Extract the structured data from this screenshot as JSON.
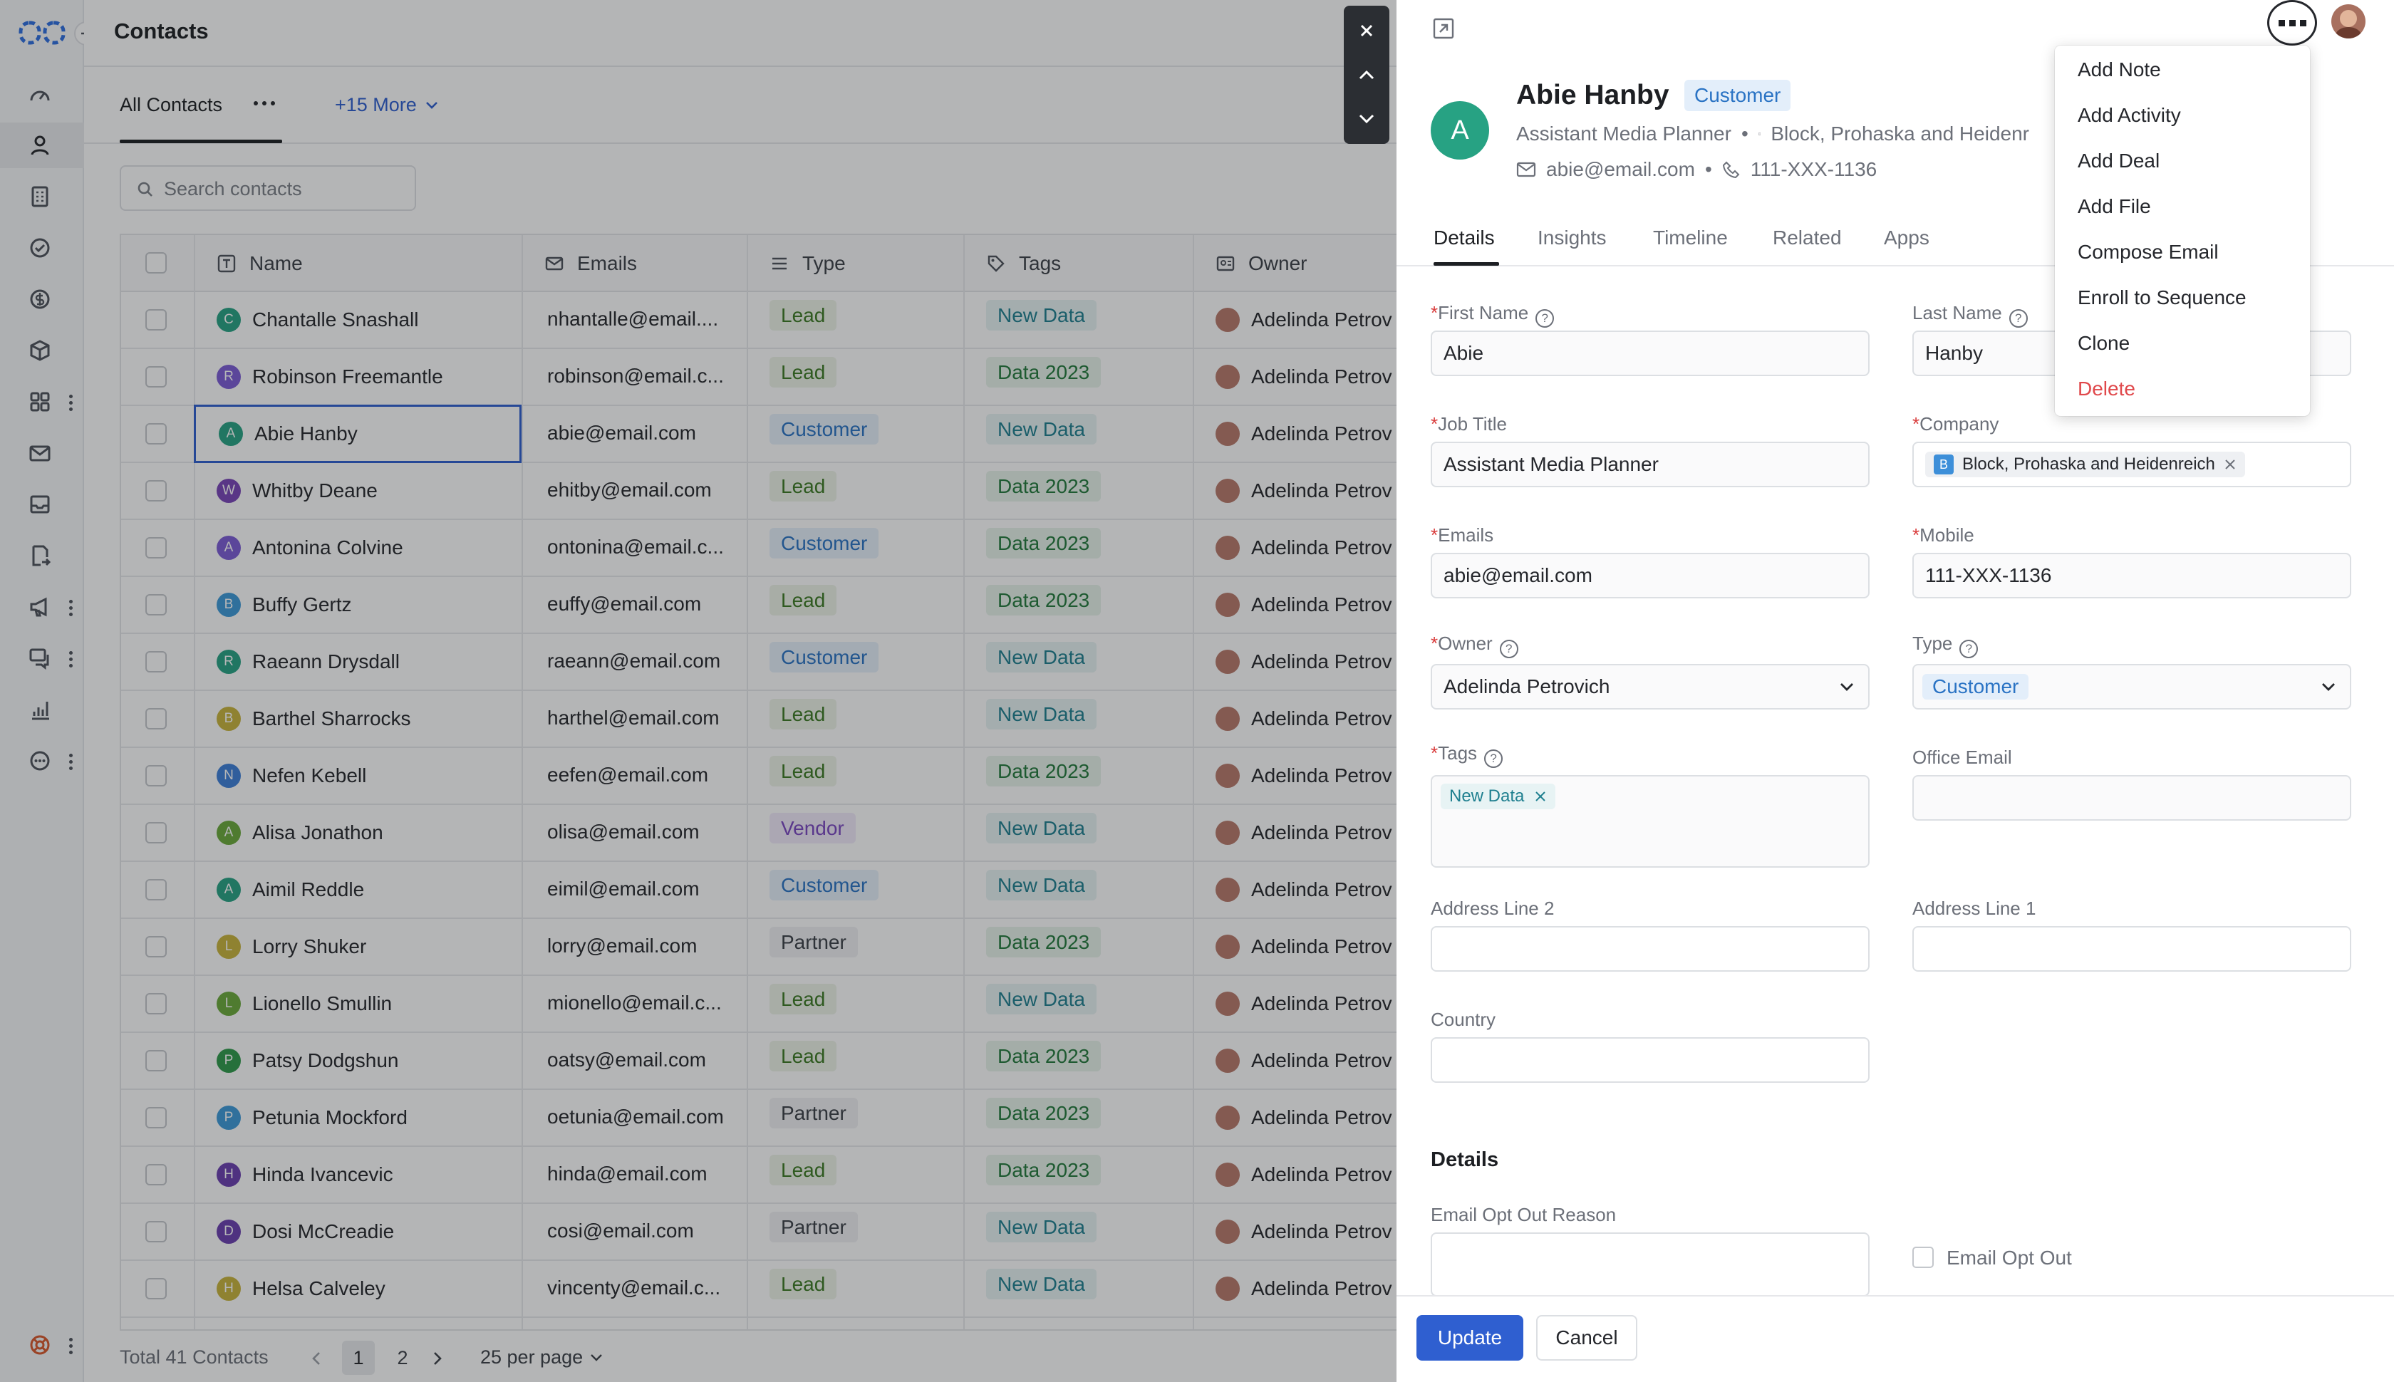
{
  "app": {
    "page_title": "Contacts"
  },
  "view_tabs": {
    "active": "All Contacts",
    "more": "+15 More"
  },
  "search": {
    "placeholder": "Search contacts"
  },
  "columns": {
    "name": "Name",
    "emails": "Emails",
    "type": "Type",
    "tags": "Tags",
    "owner": "Owner"
  },
  "rows": [
    {
      "initial": "C",
      "color": "#27a283",
      "name": "Chantalle Snashall",
      "email": "nhantalle@email....",
      "type": "Lead",
      "tag": "New Data",
      "owner": "Adelinda Petrov"
    },
    {
      "initial": "R",
      "color": "#7c5cd6",
      "name": "Robinson Freemantle",
      "email": "robinson@email.c...",
      "type": "Lead",
      "tag": "Data 2023",
      "owner": "Adelinda Petrov"
    },
    {
      "initial": "A",
      "color": "#27a283",
      "name": "Abie Hanby",
      "email": "abie@email.com",
      "type": "Customer",
      "tag": "New Data",
      "owner": "Adelinda Petrov"
    },
    {
      "initial": "W",
      "color": "#7a45b8",
      "name": "Whitby Deane",
      "email": "ehitby@email.com",
      "type": "Lead",
      "tag": "Data 2023",
      "owner": "Adelinda Petrov"
    },
    {
      "initial": "A",
      "color": "#7c5cd6",
      "name": "Antonina Colvine",
      "email": "ontonina@email.c...",
      "type": "Customer",
      "tag": "Data 2023",
      "owner": "Adelinda Petrov"
    },
    {
      "initial": "B",
      "color": "#3d9ad9",
      "name": "Buffy Gertz",
      "email": "euffy@email.com",
      "type": "Lead",
      "tag": "Data 2023",
      "owner": "Adelinda Petrov"
    },
    {
      "initial": "R",
      "color": "#27a283",
      "name": "Raeann Drysdall",
      "email": "raeann@email.com",
      "type": "Customer",
      "tag": "New Data",
      "owner": "Adelinda Petrov"
    },
    {
      "initial": "B",
      "color": "#c9b43c",
      "name": "Barthel Sharrocks",
      "email": "harthel@email.com",
      "type": "Lead",
      "tag": "New Data",
      "owner": "Adelinda Petrov"
    },
    {
      "initial": "N",
      "color": "#3d7fd9",
      "name": "Nefen Kebell",
      "email": "eefen@email.com",
      "type": "Lead",
      "tag": "Data 2023",
      "owner": "Adelinda Petrov"
    },
    {
      "initial": "A",
      "color": "#6aaa3a",
      "name": "Alisa Jonathon",
      "email": "olisa@email.com",
      "type": "Vendor",
      "tag": "New Data",
      "owner": "Adelinda Petrov"
    },
    {
      "initial": "A",
      "color": "#27a283",
      "name": "Aimil Reddle",
      "email": "eimil@email.com",
      "type": "Customer",
      "tag": "New Data",
      "owner": "Adelinda Petrov"
    },
    {
      "initial": "L",
      "color": "#c9b43c",
      "name": "Lorry Shuker",
      "email": "lorry@email.com",
      "type": "Partner",
      "tag": "Data 2023",
      "owner": "Adelinda Petrov"
    },
    {
      "initial": "L",
      "color": "#6aaa3a",
      "name": "Lionello Smullin",
      "email": "mionello@email.c...",
      "type": "Lead",
      "tag": "New Data",
      "owner": "Adelinda Petrov"
    },
    {
      "initial": "P",
      "color": "#2f9a4a",
      "name": "Patsy Dodgshun",
      "email": "oatsy@email.com",
      "type": "Lead",
      "tag": "Data 2023",
      "owner": "Adelinda Petrov"
    },
    {
      "initial": "P",
      "color": "#3d9ad9",
      "name": "Petunia Mockford",
      "email": "oetunia@email.com",
      "type": "Partner",
      "tag": "Data 2023",
      "owner": "Adelinda Petrov"
    },
    {
      "initial": "H",
      "color": "#6a3fb0",
      "name": "Hinda Ivancevic",
      "email": "hinda@email.com",
      "type": "Lead",
      "tag": "Data 2023",
      "owner": "Adelinda Petrov"
    },
    {
      "initial": "D",
      "color": "#6a3fb0",
      "name": "Dosi McCreadie",
      "email": "cosi@email.com",
      "type": "Partner",
      "tag": "New Data",
      "owner": "Adelinda Petrov"
    },
    {
      "initial": "H",
      "color": "#c9b43c",
      "name": "Helsa Calveley",
      "email": "vincenty@email.c...",
      "type": "Lead",
      "tag": "New Data",
      "owner": "Adelinda Petrov"
    }
  ],
  "footer": {
    "total": "Total 41 Contacts",
    "pages": [
      "1",
      "2"
    ],
    "per_page": "25 per page"
  },
  "record": {
    "initial": "A",
    "name": "Abie Hanby",
    "type_badge": "Customer",
    "job_title": "Assistant Media Planner",
    "company": "Block, Prohaska and Heidenr",
    "email": "abie@email.com",
    "phone": "111-XXX-1136"
  },
  "record_tabs": [
    "Details",
    "Insights",
    "Timeline",
    "Related",
    "Apps"
  ],
  "form": {
    "first_name_label": "First Name",
    "first_name": "Abie",
    "last_name_label": "Last Name",
    "last_name": "Hanby",
    "job_title_label": "Job Title",
    "job_title": "Assistant Media Planner",
    "company_label": "Company",
    "company_initial": "B",
    "company": "Block, Prohaska and Heidenreich",
    "emails_label": "Emails",
    "emails": "abie@email.com",
    "mobile_label": "Mobile",
    "mobile": "111-XXX-1136",
    "owner_label": "Owner",
    "owner": "Adelinda Petrovich",
    "type_label": "Type",
    "type": "Customer",
    "tags_label": "Tags",
    "tag": "New Data",
    "office_email_label": "Office Email",
    "address2_label": "Address Line 2",
    "address1_label": "Address Line 1",
    "country_label": "Country",
    "section_details": "Details",
    "opt_out_reason_label": "Email Opt Out Reason",
    "opt_out_label": "Email Opt Out",
    "update": "Update",
    "cancel": "Cancel"
  },
  "menu": [
    "Add Note",
    "Add Activity",
    "Add Deal",
    "Add File",
    "Compose Email",
    "Enroll to Sequence",
    "Clone",
    "Delete"
  ],
  "colors": {
    "accent": "#2f5fd0",
    "danger": "#e0484b"
  }
}
